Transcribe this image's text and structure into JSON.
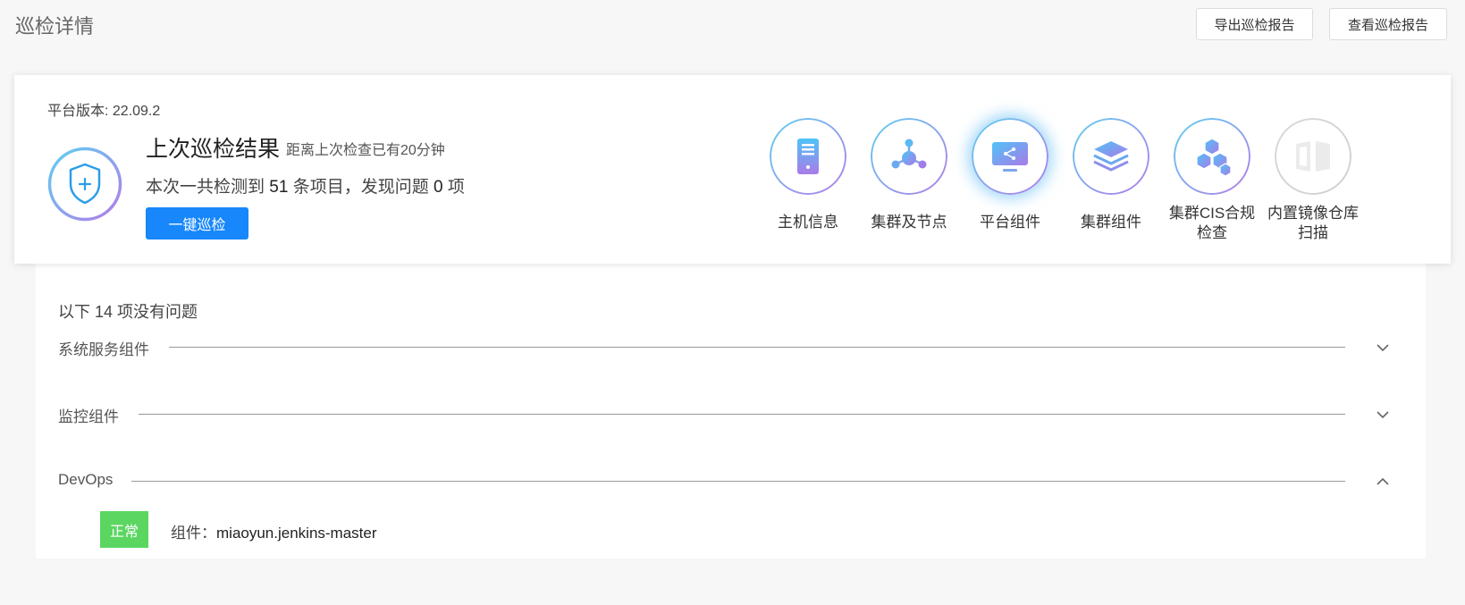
{
  "page": {
    "title": "巡检详情",
    "export_button": "导出巡检报告",
    "view_button": "查看巡检报告"
  },
  "summary": {
    "version_label": "平台版本: 22.09.2",
    "result_title": "上次巡检结果",
    "result_elapsed": "距离上次检查已有20分钟",
    "detect_prefix": "本次一共检测到 ",
    "detect_count": "51",
    "detect_middle": " 条项目，发现问题 ",
    "issue_count": "0",
    "issue_suffix": " 项",
    "scan_button": "一键巡检"
  },
  "categories": [
    {
      "label": "主机信息",
      "icon": "server-icon"
    },
    {
      "label": "集群及节点",
      "icon": "cluster-nodes-icon"
    },
    {
      "label": "平台组件",
      "icon": "monitor-share-icon",
      "active": true
    },
    {
      "label": "集群组件",
      "icon": "layers-icon"
    },
    {
      "label": "集群CIS合规",
      "label2": "检查",
      "icon": "cubes-icon"
    },
    {
      "label": "内置镜像仓库",
      "label2": "扫描",
      "icon": "book-icon",
      "disabled": true
    }
  ],
  "details": {
    "ok_prefix": "以下 ",
    "ok_count": "14",
    "ok_suffix": " 项没有问题",
    "sections": [
      {
        "name": "系统服务组件",
        "expanded": false
      },
      {
        "name": "监控组件",
        "expanded": false
      },
      {
        "name": "DevOps",
        "expanded": true
      }
    ],
    "items": [
      {
        "status": "正常",
        "label": "组件：",
        "value": "miaoyun.jenkins-master"
      }
    ]
  },
  "colors": {
    "primary": "#1787fb",
    "success": "#5bd661",
    "gradient_start": "#5fd0f0",
    "gradient_end": "#b37ce8"
  }
}
